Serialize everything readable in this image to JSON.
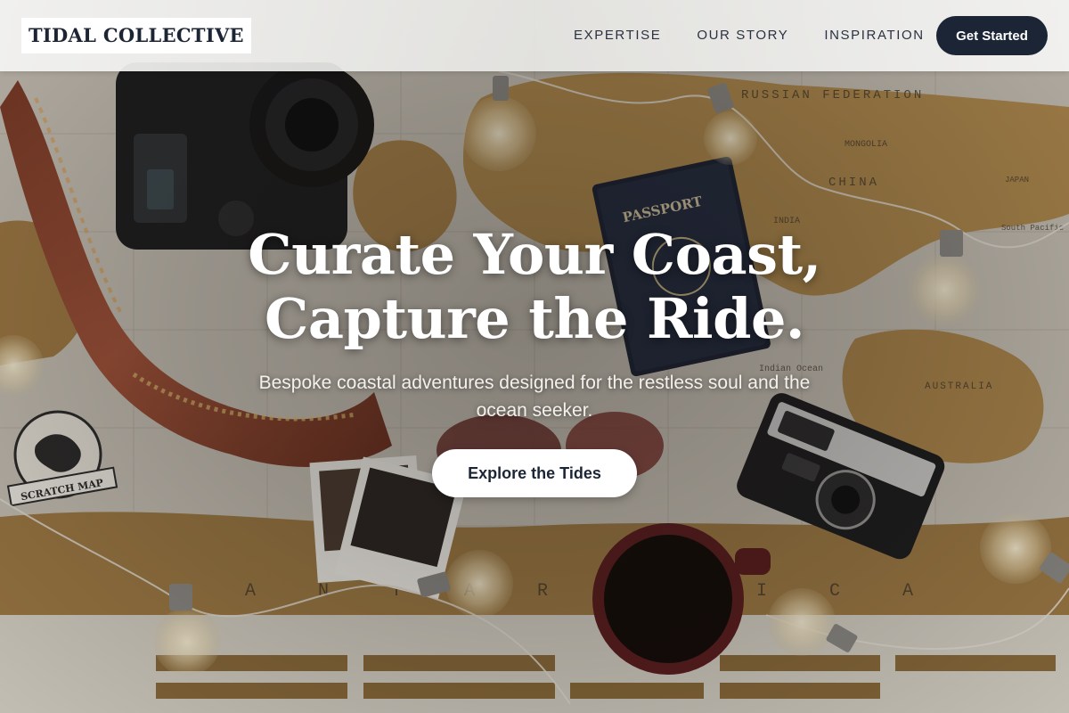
{
  "brand": {
    "logo_text": "TIDAL COLLECTIVE"
  },
  "nav": {
    "items": [
      {
        "label": "EXPERTISE"
      },
      {
        "label": "OUR STORY"
      },
      {
        "label": "INSPIRATION"
      }
    ],
    "cta_label": "Get Started"
  },
  "hero": {
    "title_line1": "Curate Your Coast,",
    "title_line2": "Capture the Ride.",
    "subtitle": "Bespoke coastal adventures designed for the restless soul and the ocean seeker.",
    "button_label": "Explore the Tides",
    "background_image": {
      "map_labels": [
        "RUSSIAN FEDERATION",
        "MONGOLIA",
        "CHINA",
        "JAPAN",
        "INDIA",
        "AUSTRALIA",
        "Indian Ocean",
        "South Pacific Ocean",
        "A N T A R C T I C A"
      ],
      "passport_text": "PASSPORT",
      "map_tag_text": "SCRATCH MAP"
    }
  },
  "colors": {
    "accent_navy": "#1c2536",
    "text_dark": "#2b3140",
    "hero_text": "#ffffff"
  }
}
